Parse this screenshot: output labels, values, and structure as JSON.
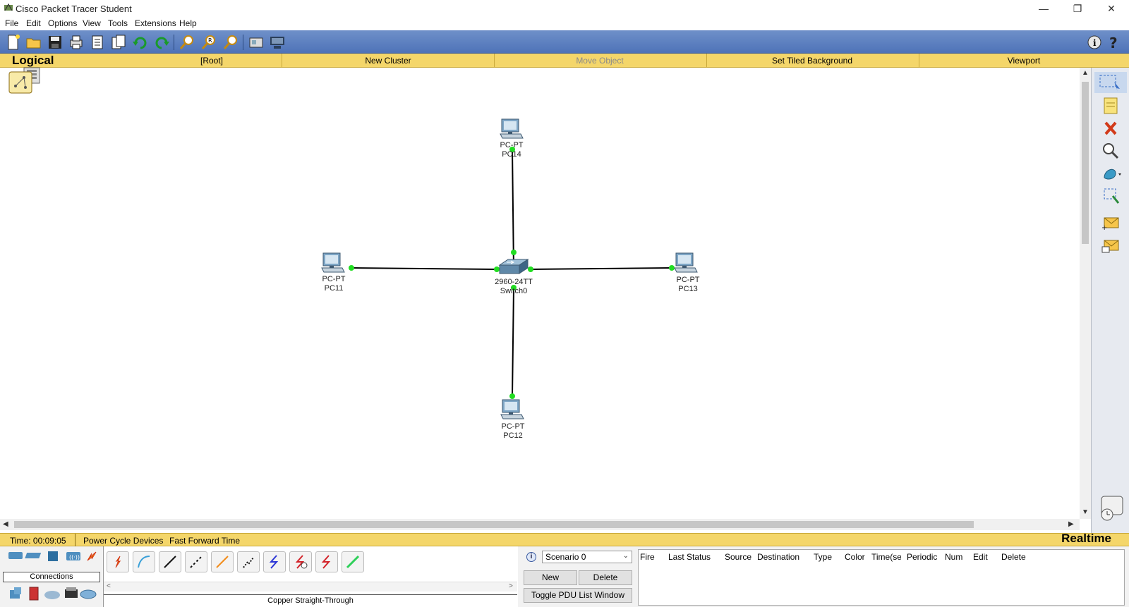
{
  "window": {
    "title": "Cisco Packet Tracer Student",
    "min": "—",
    "max": "❐",
    "close": "✕"
  },
  "menu": [
    "File",
    "Edit",
    "Options",
    "View",
    "Tools",
    "Extensions",
    "Help"
  ],
  "workspace_bar": {
    "logical": "Logical",
    "root": "[Root]",
    "new_cluster": "New Cluster",
    "move_object": "Move Object",
    "set_tiled_background": "Set Tiled Background",
    "viewport": "Viewport"
  },
  "devices": [
    {
      "model": "PC-PT",
      "name": "PC14"
    },
    {
      "model": "PC-PT",
      "name": "PC11"
    },
    {
      "model": "2960-24TT",
      "name": "Switch0"
    },
    {
      "model": "PC-PT",
      "name": "PC13"
    },
    {
      "model": "PC-PT",
      "name": "PC12"
    }
  ],
  "status": {
    "time": "Time: 00:09:05",
    "power_cycle": "Power Cycle Devices",
    "fast_forward": "Fast Forward Time",
    "mode": "Realtime"
  },
  "bottom": {
    "connections_label": "Connections",
    "selected_cable": "Copper Straight-Through",
    "scenario": "Scenario 0",
    "new_button": "New",
    "delete_button": "Delete",
    "toggle_pdu": "Toggle PDU List Window",
    "pdu_columns": [
      "Fire",
      "Last Status",
      "Source",
      "Destination",
      "Type",
      "Color",
      "Time(sec)",
      "Periodic",
      "Num",
      "Edit",
      "Delete"
    ]
  },
  "colors": {
    "toolbar": "#5a7dc0",
    "workspace_bar": "#f4d66a",
    "link": "#000000",
    "port_up": "#22dd22"
  }
}
